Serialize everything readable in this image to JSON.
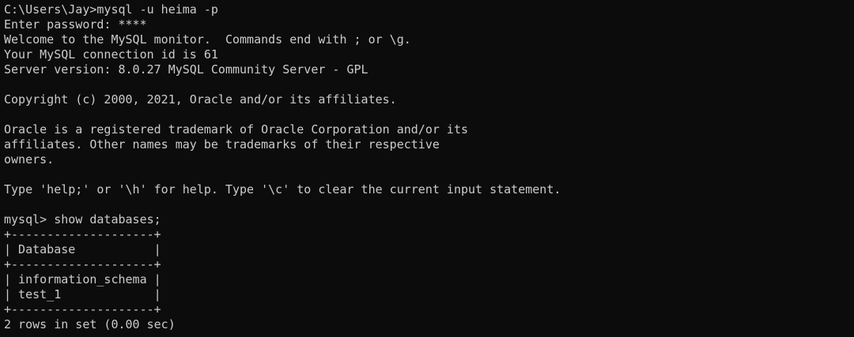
{
  "terminal": {
    "lines": [
      "C:\\Users\\Jay>mysql -u heima -p",
      "Enter password: ****",
      "Welcome to the MySQL monitor.  Commands end with ; or \\g.",
      "Your MySQL connection id is 61",
      "Server version: 8.0.27 MySQL Community Server - GPL",
      "",
      "Copyright (c) 2000, 2021, Oracle and/or its affiliates.",
      "",
      "Oracle is a registered trademark of Oracle Corporation and/or its",
      "affiliates. Other names may be trademarks of their respective",
      "owners.",
      "",
      "Type 'help;' or '\\h' for help. Type '\\c' to clear the current input statement.",
      "",
      "mysql> show databases;",
      "+--------------------+",
      "| Database           |",
      "+--------------------+",
      "| information_schema |",
      "| test_1             |",
      "+--------------------+",
      "2 rows in set (0.00 sec)"
    ]
  }
}
